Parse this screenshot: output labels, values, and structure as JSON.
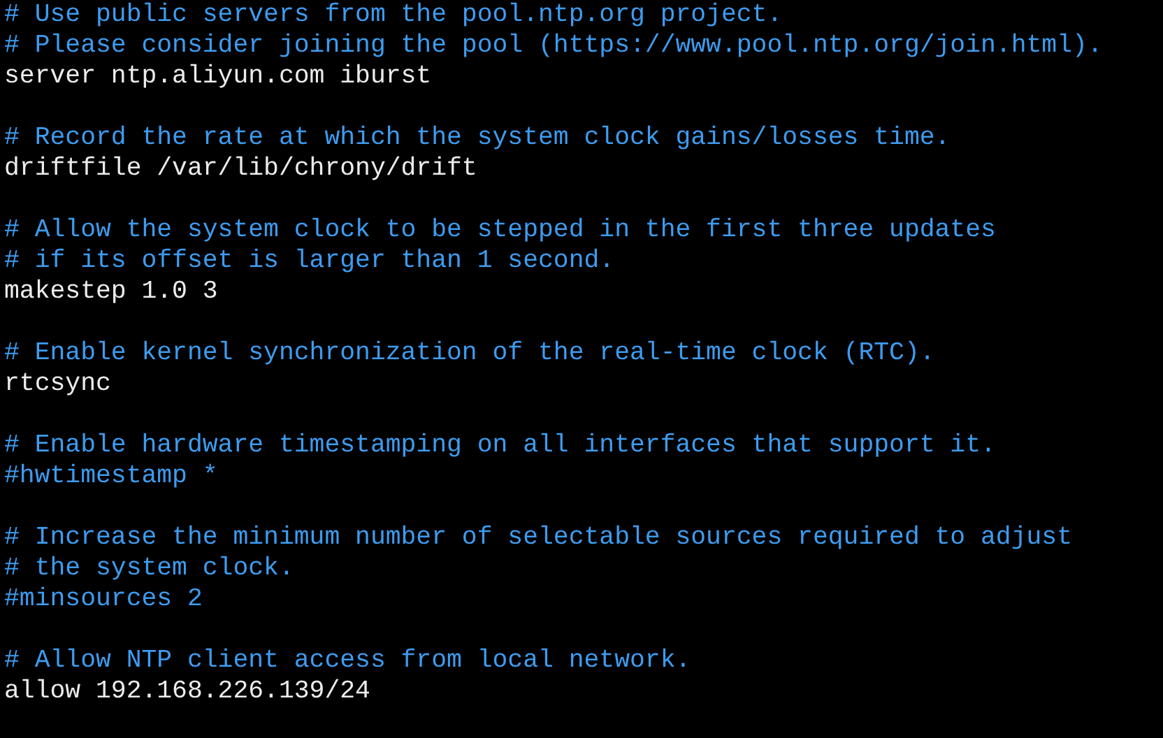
{
  "editor": {
    "lines": [
      {
        "kind": "comment",
        "text": "# Use public servers from the pool.ntp.org project."
      },
      {
        "kind": "comment",
        "text": "# Please consider joining the pool (https://www.pool.ntp.org/join.html)."
      },
      {
        "kind": "directive",
        "text": "server ntp.aliyun.com iburst"
      },
      {
        "kind": "blank"
      },
      {
        "kind": "comment",
        "text": "# Record the rate at which the system clock gains/losses time."
      },
      {
        "kind": "directive",
        "text": "driftfile /var/lib/chrony/drift"
      },
      {
        "kind": "blank"
      },
      {
        "kind": "comment",
        "text": "# Allow the system clock to be stepped in the first three updates"
      },
      {
        "kind": "comment",
        "text": "# if its offset is larger than 1 second."
      },
      {
        "kind": "directive",
        "text": "makestep 1.0 3"
      },
      {
        "kind": "blank"
      },
      {
        "kind": "comment",
        "text": "# Enable kernel synchronization of the real-time clock (RTC)."
      },
      {
        "kind": "directive",
        "text": "rtcsync"
      },
      {
        "kind": "blank"
      },
      {
        "kind": "comment",
        "text": "# Enable hardware timestamping on all interfaces that support it."
      },
      {
        "kind": "comment",
        "text": "#hwtimestamp *"
      },
      {
        "kind": "blank"
      },
      {
        "kind": "comment",
        "text": "# Increase the minimum number of selectable sources required to adjust"
      },
      {
        "kind": "comment",
        "text": "# the system clock."
      },
      {
        "kind": "comment",
        "text": "#minsources 2"
      },
      {
        "kind": "blank"
      },
      {
        "kind": "comment",
        "text": "# Allow NTP client access from local network."
      },
      {
        "kind": "directive",
        "text": "allow 192.168.226.139/24"
      }
    ]
  }
}
